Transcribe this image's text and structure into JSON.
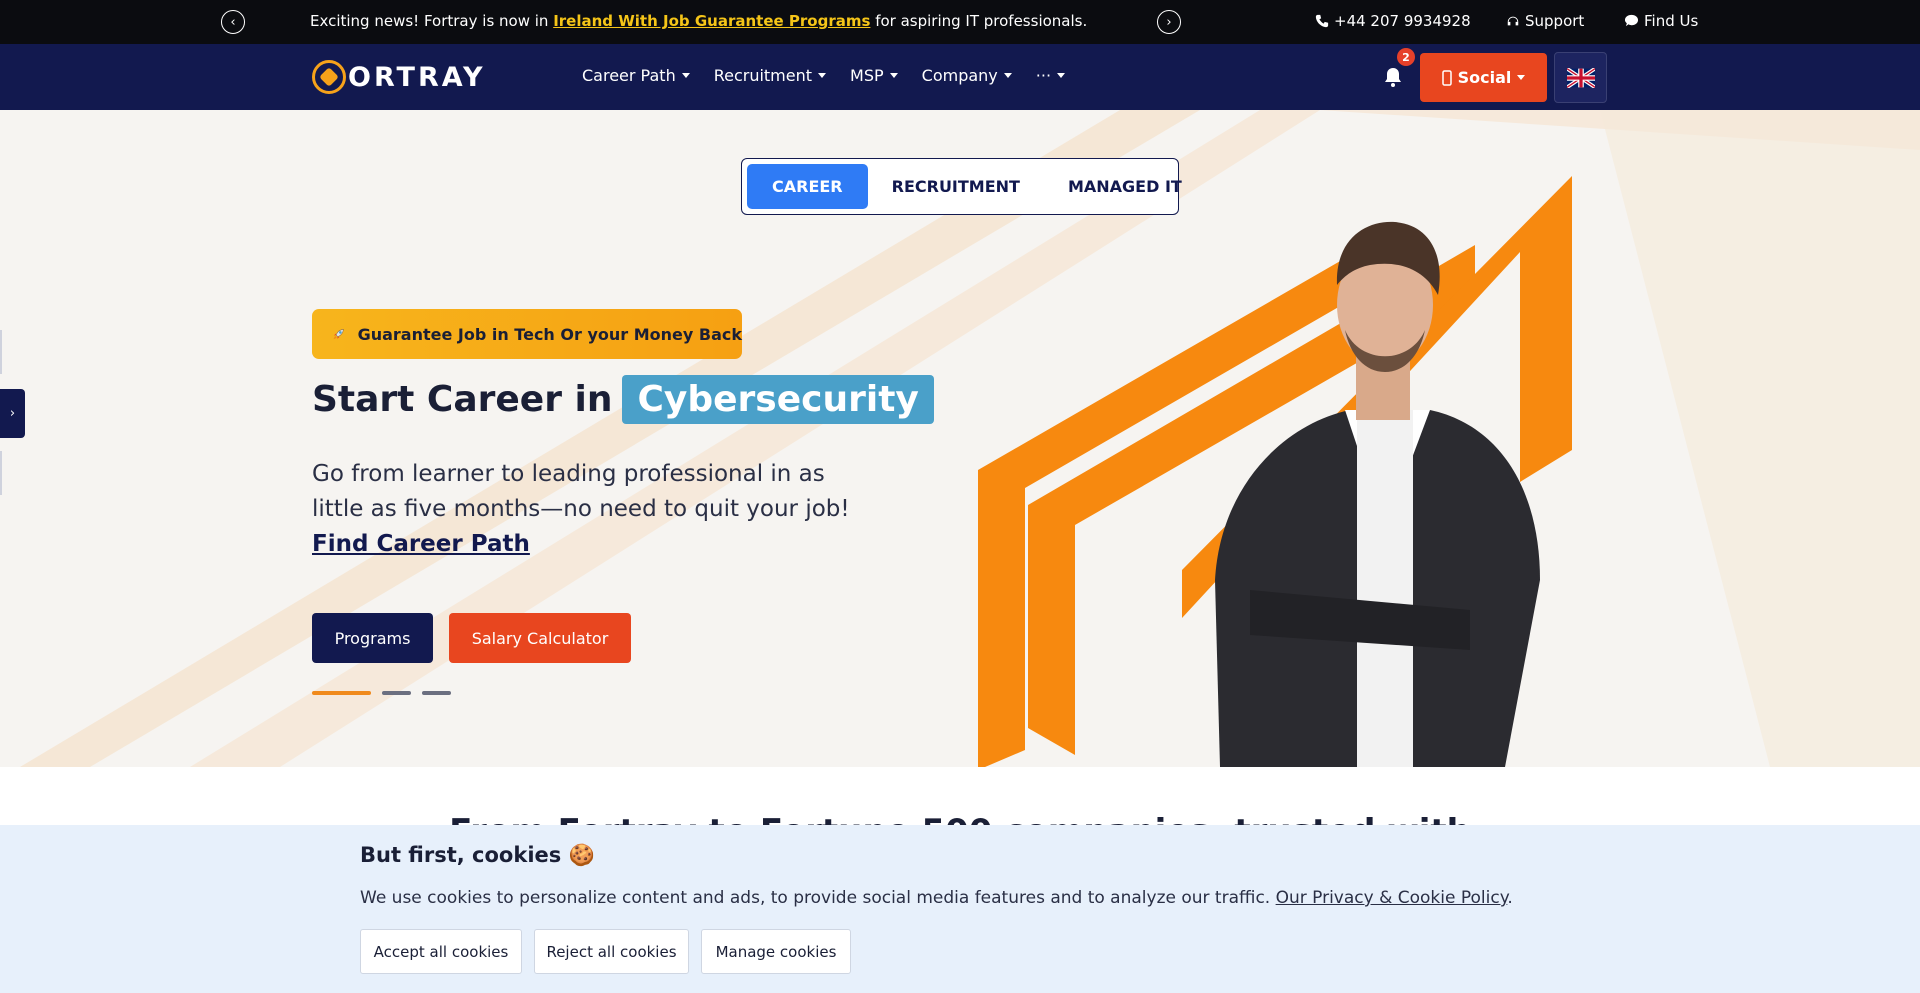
{
  "announcement": {
    "prefix": "Exciting news! Fortray is now in ",
    "link": "Ireland With Job Guarantee Programs",
    "suffix": " for aspiring IT professionals.",
    "phone": "+44 207 9934928",
    "support": "Support",
    "find_us": "Find Us",
    "prev_icon": "chevron-left-icon",
    "next_icon": "chevron-right-icon"
  },
  "nav": {
    "logo_text": "ORTRAY",
    "items": [
      {
        "label": "Career Path"
      },
      {
        "label": "Recruitment"
      },
      {
        "label": "MSP"
      },
      {
        "label": "Company"
      },
      {
        "label": "···"
      }
    ],
    "notification_count": "2",
    "social_label": "Social",
    "language_flag": "uk-flag-icon"
  },
  "hero": {
    "tabs": [
      {
        "label": "CAREER",
        "active": true
      },
      {
        "label": "RECRUITMENT",
        "active": false
      },
      {
        "label": "MANAGED IT",
        "active": false
      }
    ],
    "pill_text": "Guarantee Job in Tech Or your Money Back",
    "headline_prefix": "Start Career in",
    "headline_highlight": "Cybersecurity",
    "subtext": "Go from learner to leading professional in as little as five months—no need to quit your job! ",
    "subtext_link": "Find Career Path",
    "btn_programs": "Programs",
    "btn_salary": "Salary Calculator",
    "slide_count": 3,
    "active_slide": 1
  },
  "section_title": "From Fortray to Fortune 500 companies, trusted with",
  "cookie": {
    "title": "But first, cookies 🍪",
    "text": "We use cookies to personalize content and ads, to provide social media features and to analyze our traffic. ",
    "policy_link": "Our Privacy & Cookie Policy",
    "accept": "Accept all cookies",
    "reject": "Reject all cookies",
    "manage": "Manage cookies"
  },
  "colors": {
    "navy": "#12194f",
    "orange": "#f08a1c",
    "red": "#e8461f",
    "tab_blue": "#2f7bf5",
    "highlight_teal": "#4aa0c9"
  }
}
